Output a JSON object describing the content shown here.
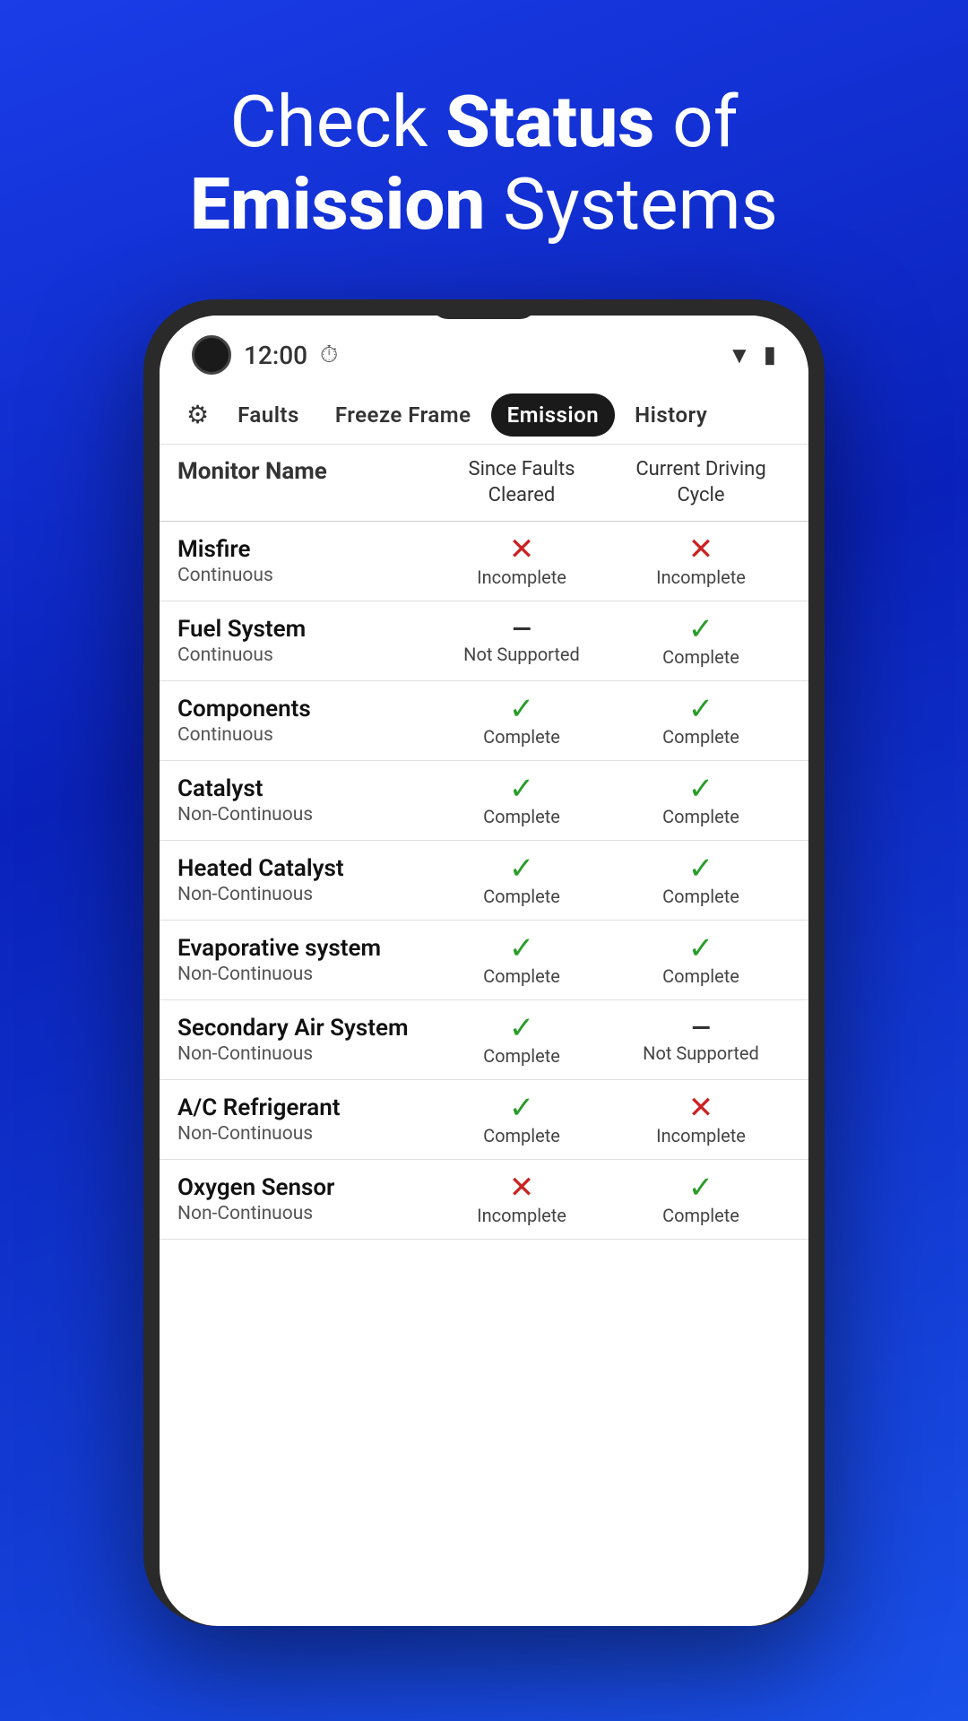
{
  "hero": {
    "title_line1": "Check",
    "title_bold1": "Status",
    "title_line1b": "of",
    "title_bold2": "Emission",
    "title_line2b": "Systems"
  },
  "statusBar": {
    "time": "12:00",
    "wifi": "wifi",
    "battery": "battery"
  },
  "tabs": [
    {
      "id": "faults",
      "label": "Faults",
      "active": false
    },
    {
      "id": "freeze-frame",
      "label": "Freeze Frame",
      "active": false
    },
    {
      "id": "emission",
      "label": "Emission",
      "active": true
    },
    {
      "id": "history",
      "label": "History",
      "active": false
    }
  ],
  "tableHeader": {
    "col1": "Monitor Name",
    "col2": "Since Faults Cleared",
    "col3": "Current Driving Cycle"
  },
  "monitors": [
    {
      "name": "Misfire",
      "type": "Continuous",
      "sinceFaults": "incomplete",
      "sinceFaultsText": "Incomplete",
      "currentCycle": "incomplete",
      "currentCycleText": "Incomplete"
    },
    {
      "name": "Fuel System",
      "type": "Continuous",
      "sinceFaults": "not-supported",
      "sinceFaultsText": "Not Supported",
      "currentCycle": "complete",
      "currentCycleText": "Complete"
    },
    {
      "name": "Components",
      "type": "Continuous",
      "sinceFaults": "complete",
      "sinceFaultsText": "Complete",
      "currentCycle": "complete",
      "currentCycleText": "Complete"
    },
    {
      "name": "Catalyst",
      "type": "Non-Continuous",
      "sinceFaults": "complete",
      "sinceFaultsText": "Complete",
      "currentCycle": "complete",
      "currentCycleText": "Complete"
    },
    {
      "name": "Heated Catalyst",
      "type": "Non-Continuous",
      "sinceFaults": "complete",
      "sinceFaultsText": "Complete",
      "currentCycle": "complete",
      "currentCycleText": "Complete"
    },
    {
      "name": "Evaporative system",
      "type": "Non-Continuous",
      "sinceFaults": "complete",
      "sinceFaultsText": "Complete",
      "currentCycle": "complete",
      "currentCycleText": "Complete"
    },
    {
      "name": "Secondary Air System",
      "type": "Non-Continuous",
      "sinceFaults": "complete",
      "sinceFaultsText": "Complete",
      "currentCycle": "not-supported",
      "currentCycleText": "Not Supported"
    },
    {
      "name": "A/C Refrigerant",
      "type": "Non-Continuous",
      "sinceFaults": "complete",
      "sinceFaultsText": "Complete",
      "currentCycle": "incomplete",
      "currentCycleText": "Incomplete"
    },
    {
      "name": "Oxygen Sensor",
      "type": "Non-Continuous",
      "sinceFaults": "incomplete",
      "sinceFaultsText": "Incomplete",
      "currentCycle": "complete",
      "currentCycleText": "Complete"
    }
  ]
}
